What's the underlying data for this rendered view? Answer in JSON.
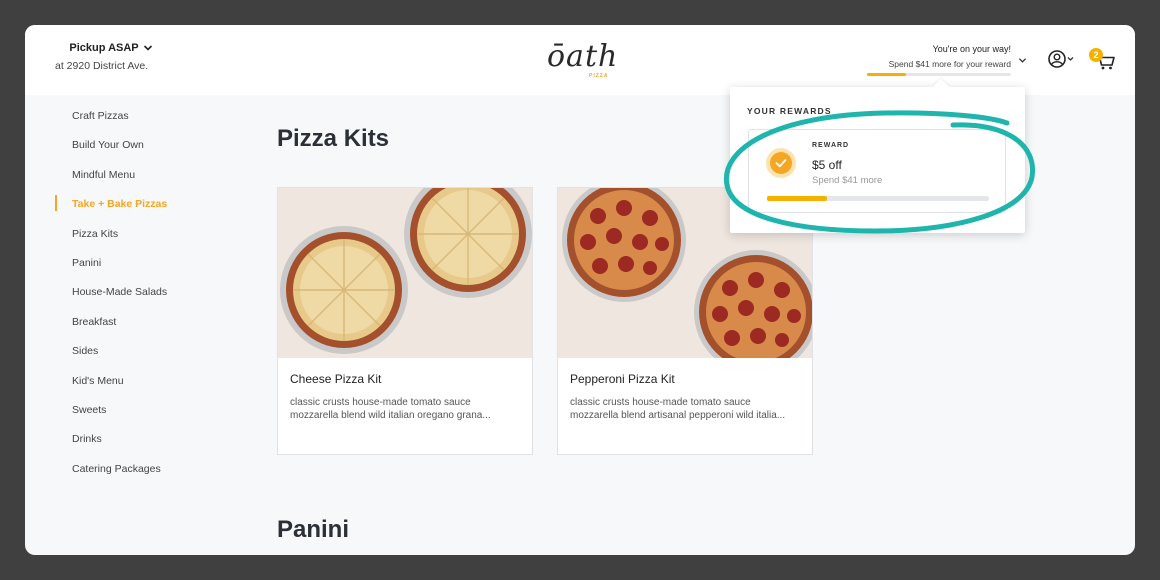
{
  "header": {
    "pickup_mode": "Pickup ASAP",
    "pickup_address": "at 2920 District Ave.",
    "logo_text": "ōath",
    "logo_sub": "PIZZA",
    "reward_status_title": "You're on your way!",
    "reward_status_sub": "Spend $41 more for your reward",
    "reward_progress": 0.27,
    "cart_count": "2"
  },
  "sidebar": {
    "items": [
      {
        "label": "Craft Pizzas"
      },
      {
        "label": "Build Your Own"
      },
      {
        "label": "Mindful Menu"
      },
      {
        "label": "Take + Bake Pizzas"
      },
      {
        "label": "Pizza Kits"
      },
      {
        "label": "Panini"
      },
      {
        "label": "House-Made Salads"
      },
      {
        "label": "Breakfast"
      },
      {
        "label": "Sides"
      },
      {
        "label": "Kid's Menu"
      },
      {
        "label": "Sweets"
      },
      {
        "label": "Drinks"
      },
      {
        "label": "Catering Packages"
      }
    ],
    "active_index": 3
  },
  "main": {
    "section_title": "Pizza Kits",
    "next_section_title": "Panini",
    "products": [
      {
        "name": "Cheese Pizza Kit",
        "desc1": "classic crusts house-made tomato sauce",
        "desc2": "mozzarella blend wild italian oregano grana..."
      },
      {
        "name": "Pepperoni Pizza Kit",
        "desc1": "classic crusts house-made tomato sauce",
        "desc2": "mozzarella blend artisanal pepperoni wild italia..."
      }
    ]
  },
  "rewards_popover": {
    "title": "YOUR REWARDS",
    "card_label": "REWARD",
    "value": "$5 off",
    "hint": "Spend $41 more",
    "progress": 0.27
  },
  "colors": {
    "accent": "#f5a623",
    "progress": "#f5b100",
    "highlight": "#1fb5ad",
    "frame": "#404040"
  }
}
